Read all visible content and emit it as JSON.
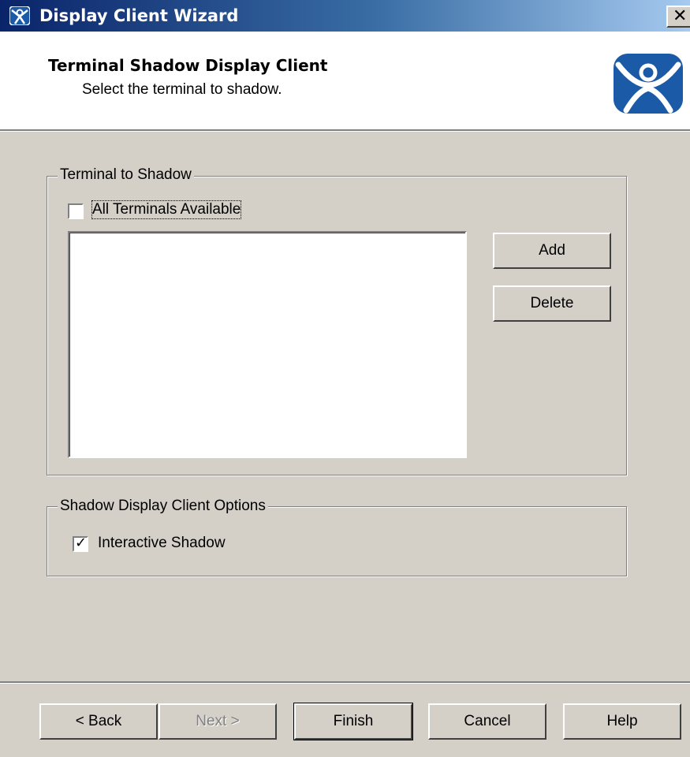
{
  "window": {
    "title": "Display Client Wizard"
  },
  "header": {
    "title": "Terminal Shadow Display Client",
    "subtitle": "Select the terminal to shadow."
  },
  "terminal_group": {
    "legend": "Terminal to Shadow",
    "all_terminals_label": "All Terminals Available",
    "all_terminals_checked": false,
    "terminals": [],
    "add_label": "Add",
    "delete_label": "Delete"
  },
  "options_group": {
    "legend": "Shadow Display Client Options",
    "interactive_label": "Interactive Shadow",
    "interactive_checked": true
  },
  "footer": {
    "back_label": "< Back",
    "next_label": "Next >",
    "finish_label": "Finish",
    "cancel_label": "Cancel",
    "help_label": "Help"
  },
  "colors": {
    "title_gradient_start": "#0a246a",
    "dialog_face": "#d4d0c8",
    "logo_blue": "#1a5aa6"
  },
  "icons": {
    "title": "app-person-icon",
    "logo": "thinmanager-logo-icon",
    "close": "close-icon",
    "check": "checkmark-icon"
  }
}
